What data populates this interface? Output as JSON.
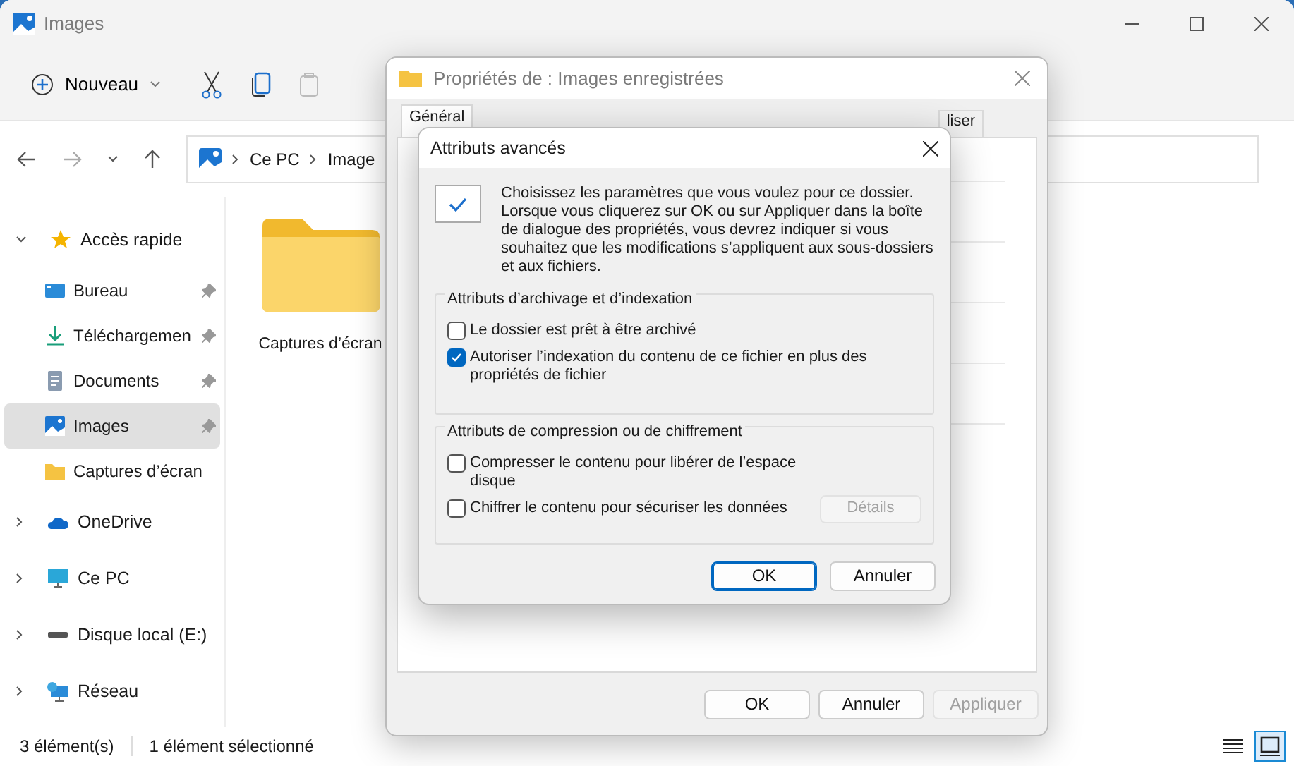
{
  "explorer": {
    "title": "Images",
    "new_button": "Nouveau",
    "breadcrumb": [
      "Ce PC",
      "Image"
    ],
    "sidebar": {
      "items": [
        {
          "label": "Accès rapide",
          "kind": "star",
          "expanded": true,
          "selected": false,
          "children": [
            {
              "label": "Bureau",
              "kind": "desktop",
              "pinned": true,
              "selected": false
            },
            {
              "label": "Téléchargemen",
              "kind": "download",
              "pinned": true,
              "selected": false
            },
            {
              "label": "Documents",
              "kind": "document",
              "pinned": true,
              "selected": false
            },
            {
              "label": "Images",
              "kind": "image",
              "pinned": true,
              "selected": true
            },
            {
              "label": "Captures d’écran",
              "kind": "folder",
              "pinned": false,
              "selected": false
            }
          ]
        },
        {
          "label": "OneDrive",
          "kind": "cloud",
          "expanded": false,
          "selected": false
        },
        {
          "label": "Ce PC",
          "kind": "monitor",
          "expanded": false,
          "selected": false
        },
        {
          "label": "Disque local (E:)",
          "kind": "drive",
          "expanded": false,
          "selected": false
        },
        {
          "label": "Réseau",
          "kind": "network",
          "expanded": false,
          "selected": false
        }
      ]
    },
    "files": [
      {
        "name": "Captures d’écran",
        "kind": "folder"
      }
    ],
    "status_bar": [
      "3 élément(s)",
      "1 élément sélectionné"
    ],
    "view_buttons": [
      {
        "kind": "details",
        "selected": false
      },
      {
        "kind": "tiles",
        "selected": true
      }
    ]
  },
  "properties": {
    "title": "Propriétés de : Images enregistrées",
    "tabs": [
      {
        "label": "Général",
        "selected": true
      },
      {
        "label": "liser",
        "selected": false
      }
    ],
    "buttons": [
      {
        "label": "OK",
        "disabled": false
      },
      {
        "label": "Annuler",
        "disabled": false
      },
      {
        "label": "Appliquer",
        "disabled": true
      }
    ]
  },
  "advanced": {
    "title": "Attributs avancés",
    "description": "Choisissez les paramètres que vous voulez pour ce dossier. Lorsque vous cliquerez sur OK ou sur Appliquer dans la boîte de dialogue des propriétés, vous devrez indiquer si vous souhaitez que les modifications s’appliquent aux sous-dossiers et aux fichiers.",
    "groups": [
      {
        "title": "Attributs d’archivage et d’indexation",
        "options": [
          {
            "label": "Le dossier est prêt à être archivé",
            "checked": false
          },
          {
            "label": "Autoriser l’indexation du contenu de ce fichier en plus des propriétés de fichier",
            "checked": true
          }
        ]
      },
      {
        "title": "Attributs de compression ou de chiffrement",
        "options": [
          {
            "label": "Compresser le contenu pour libérer de l’espace disque",
            "checked": false
          },
          {
            "label": "Chiffrer le contenu pour sécuriser les données",
            "checked": false,
            "button": {
              "label": "Détails",
              "disabled": true
            }
          }
        ]
      }
    ],
    "buttons": [
      {
        "label": "OK",
        "default": true
      },
      {
        "label": "Annuler",
        "default": false
      }
    ]
  }
}
